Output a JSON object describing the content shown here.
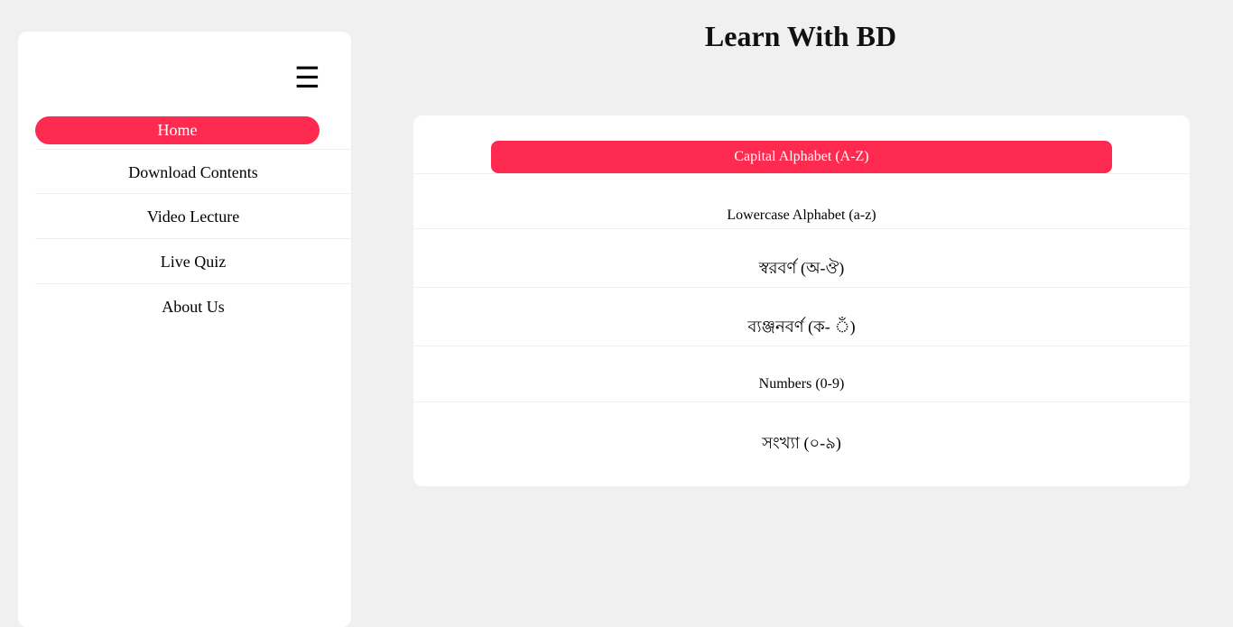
{
  "page": {
    "title": "Learn With BD"
  },
  "sidebar": {
    "menu_icon": "☰",
    "items": [
      {
        "label": "Home",
        "active": true
      },
      {
        "label": "Download Contents"
      },
      {
        "label": "Video Lecture"
      },
      {
        "label": "Live Quiz"
      },
      {
        "label": "About Us"
      }
    ]
  },
  "main": {
    "items": [
      {
        "label": "Capital Alphabet (A-Z)",
        "active": true
      },
      {
        "label": "Lowercase Alphabet (a-z)"
      },
      {
        "label": "স্বরবর্ণ (অ-ঔ)"
      },
      {
        "label": "ব্যঞ্জনবর্ণ (ক- ঁ)"
      },
      {
        "label": "Numbers (0-9)"
      },
      {
        "label": "সংখ্যা (০-৯)"
      }
    ]
  },
  "colors": {
    "accent": "#ff2a4f",
    "background": "#f0f0f0",
    "panel": "#ffffff"
  },
  "icons": {
    "menu": "hamburger-menu-icon"
  }
}
